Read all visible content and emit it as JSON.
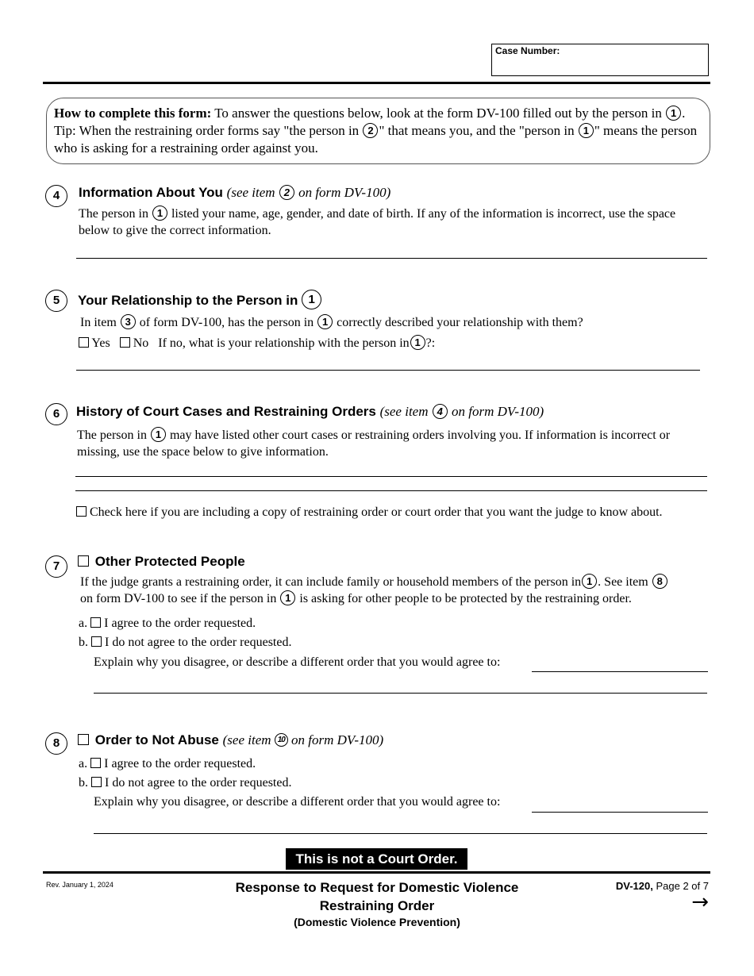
{
  "header": {
    "case_number_label": "Case Number:",
    "case_number_value": ""
  },
  "instructions": {
    "lead": "How to complete this form:",
    "t1": " To answer the questions below, look at the form DV-100 filled out by the person in ",
    "c1": "1",
    "t2": ". Tip: When the restraining order forms say \"the person in ",
    "c2": "2",
    "t3": "\" that means you, and the \"person in ",
    "c3": "1",
    "t4": "\" means the person who is asking for a restraining order against you."
  },
  "items": {
    "i4": {
      "number": "4",
      "title": "Information About You",
      "see_pre": "(see item ",
      "see_ref": "2",
      "see_post": " on form DV-100)",
      "text_pre": "The person in ",
      "text_ref": "1",
      "text_post": " listed your name, age, gender, and date of birth. If any of the information is incorrect, use the space below to give the correct information.",
      "answer": ""
    },
    "i5": {
      "number": "5",
      "title": "Your Relationship to the Person in",
      "title_ref": "1",
      "q_pre": "In item ",
      "q_ref1": "3",
      "q_mid": " of form DV-100, has the person in ",
      "q_ref2": "1",
      "q_post": " correctly described your relationship with them?",
      "yes_label": "Yes",
      "no_label": "No",
      "yes_checked": false,
      "no_checked": false,
      "ifno_pre": "If no, what is your relationship with the person in",
      "ifno_ref": "1",
      "ifno_post": "?:",
      "answer": ""
    },
    "i6": {
      "number": "6",
      "title": "History of Court Cases and Restraining Orders",
      "see_pre": "(see item ",
      "see_ref": "4",
      "see_post": " on form DV-100)",
      "text_pre": "The person in ",
      "text_ref": "1",
      "text_post": " may have listed other court cases or restraining orders involving you. If information is incorrect or missing, use the space below to give information.",
      "answer_line1": "",
      "answer_line2": "",
      "copy_label": "Check here if you are including a copy of restraining order or court order that you want the judge to know about.",
      "copy_checked": false
    },
    "i7": {
      "number": "7",
      "title": "Other Protected People",
      "title_checked": false,
      "text_a": "If the judge grants a restraining order, it can include family or household members of the person in",
      "ref1": "1",
      "text_b": ". See item ",
      "ref2": "8",
      "text_c": "on form DV-100 to see if the person in ",
      "ref3": "1",
      "text_d": " is asking for other people to be protected by the restraining order.",
      "opt_a_letter": "a.",
      "opt_a_label": "I agree to the order requested.",
      "opt_a_checked": false,
      "opt_b_letter": "b.",
      "opt_b_label": "I do not agree to the order requested.",
      "opt_b_checked": false,
      "explain_label": "Explain why you disagree, or describe a different order that you would agree to:",
      "explain_line1": "",
      "explain_line2": ""
    },
    "i8": {
      "number": "8",
      "title": "Order to Not Abuse",
      "title_checked": false,
      "see_pre": "(see item ",
      "see_ref": "10",
      "see_post": " on form DV-100)",
      "opt_a_letter": "a.",
      "opt_a_label": "I agree to the order requested.",
      "opt_a_checked": false,
      "opt_b_letter": "b.",
      "opt_b_label": "I do not agree to the order requested.",
      "opt_b_checked": false,
      "explain_label": "Explain why you disagree, or describe a different order that you would agree to:",
      "explain_line1": "",
      "explain_line2": ""
    }
  },
  "footer": {
    "not_court_order": "This is not a Court Order.",
    "revision": "Rev. January 1, 2024",
    "title_line1": "Response to Request for Domestic Violence",
    "title_line2": "Restraining Order",
    "subtitle": "(Domestic Violence Prevention)",
    "form_id": "DV-120,",
    "page_info": " Page 2 of 7",
    "next_arrow_icon": "→"
  }
}
